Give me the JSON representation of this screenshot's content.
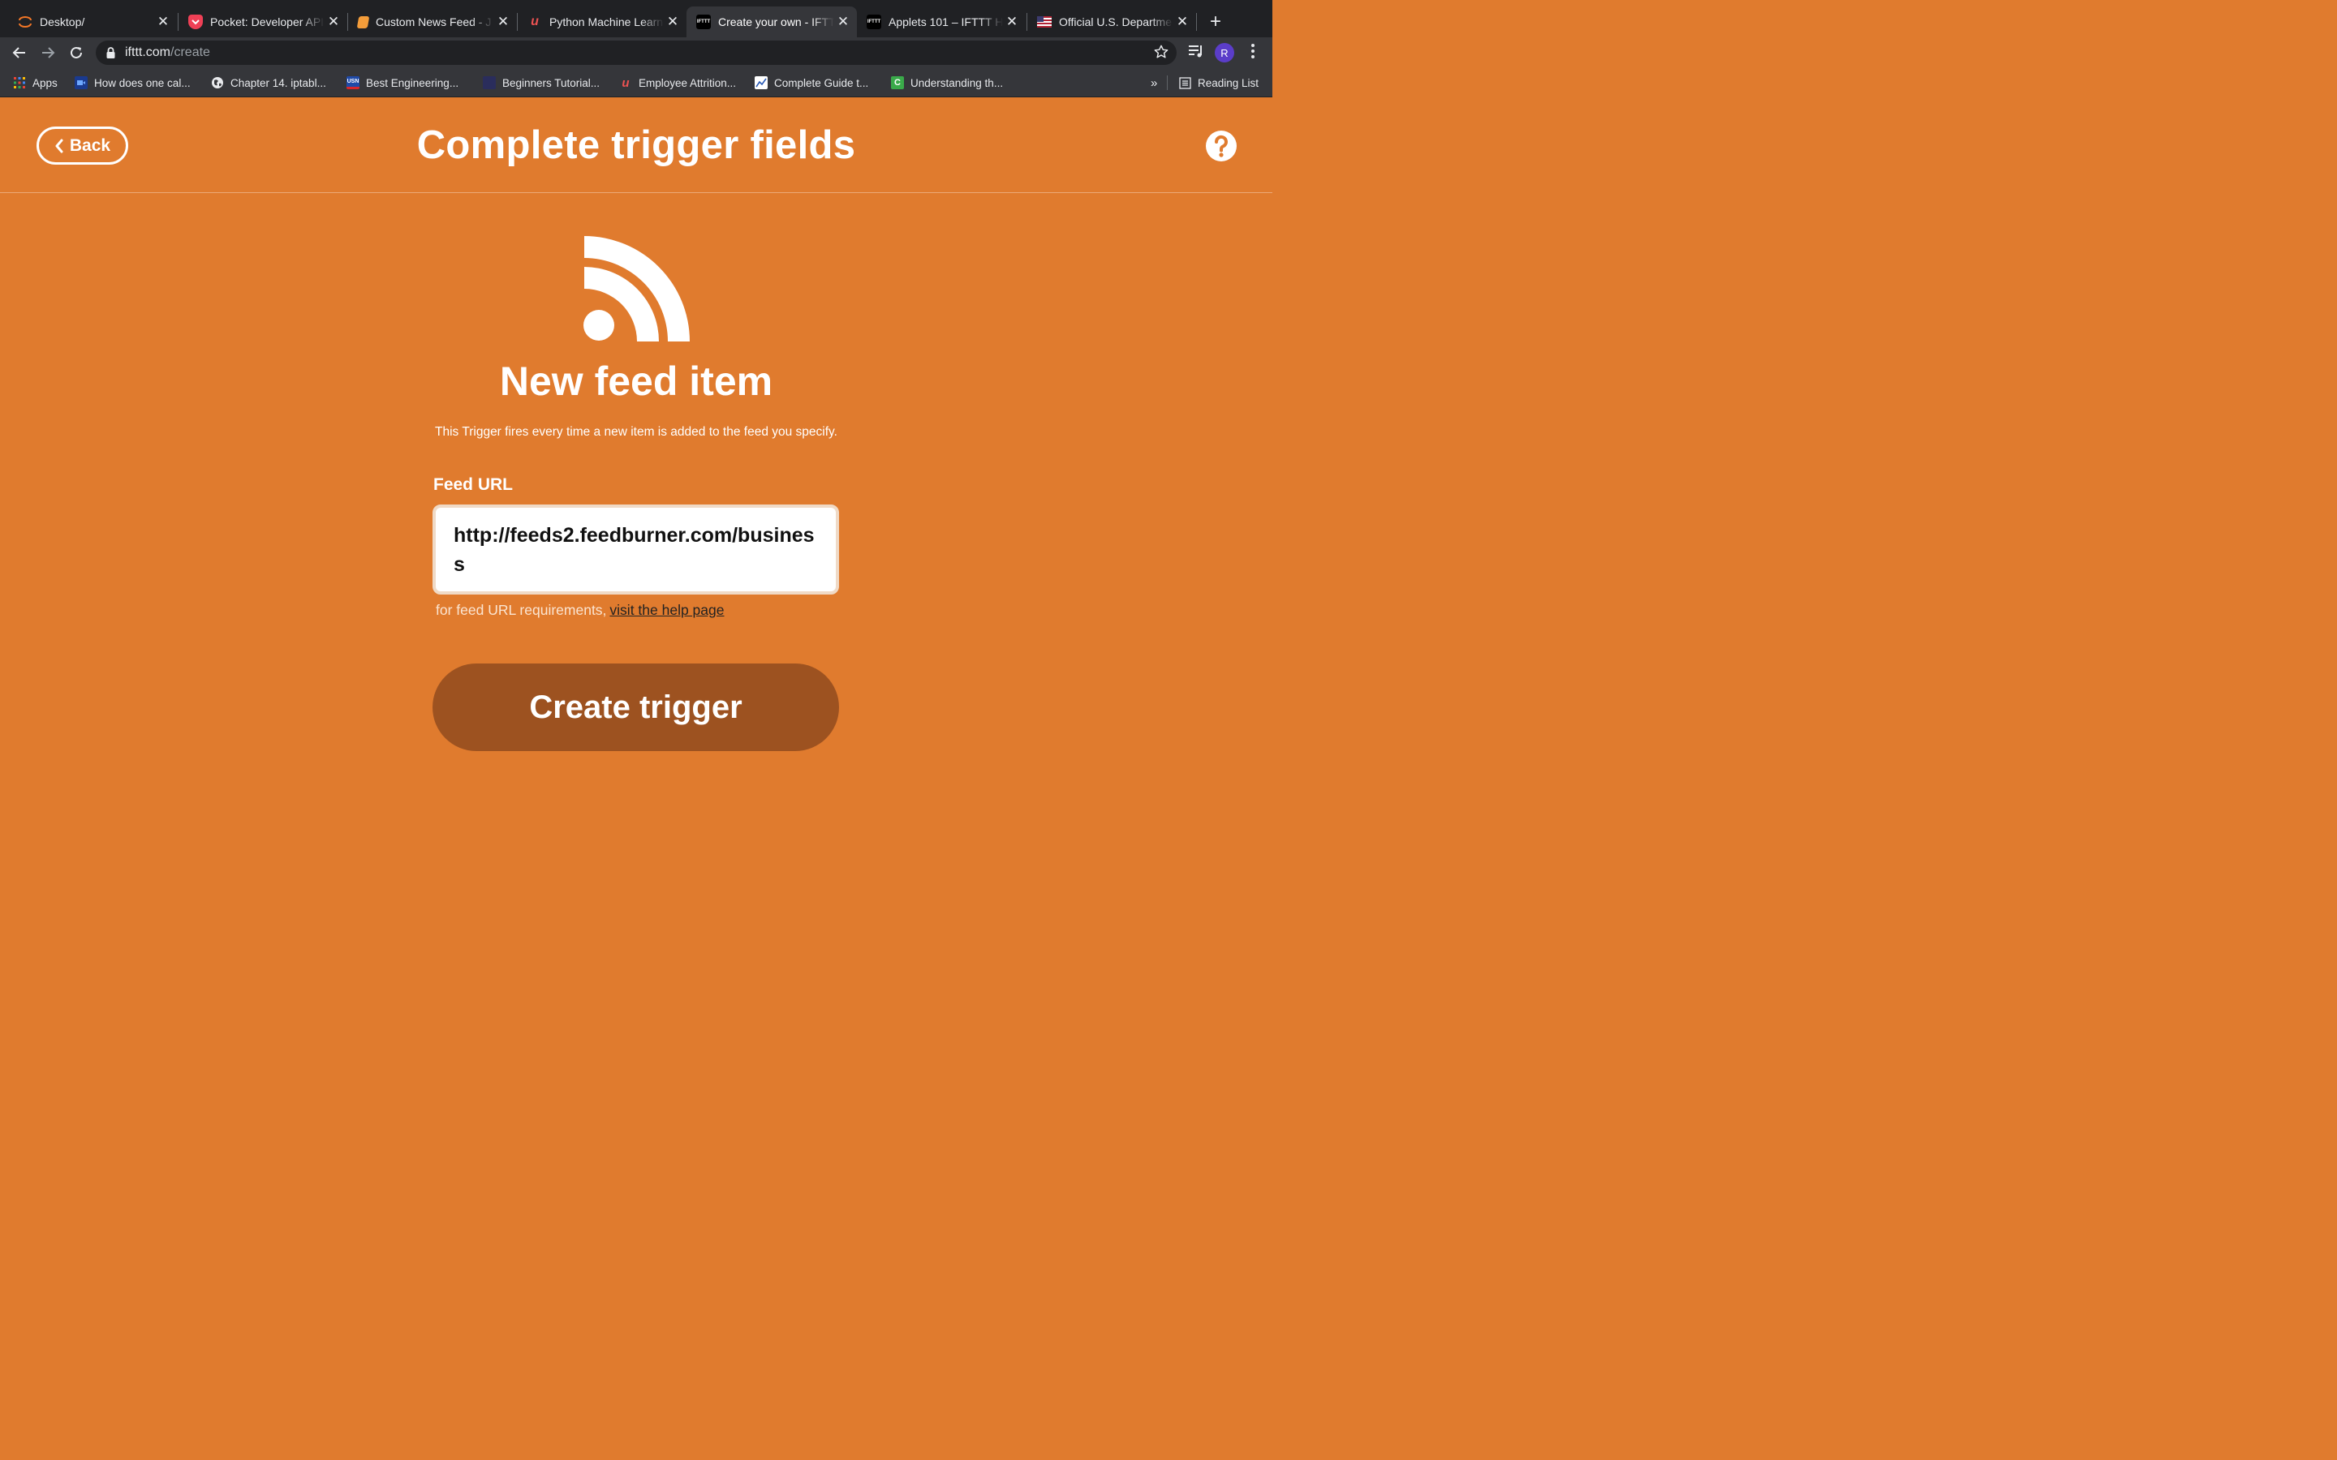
{
  "browser": {
    "tabs": [
      {
        "title": "Desktop/",
        "icon": "jupyter-icon",
        "active": false
      },
      {
        "title": "Pocket: Developer API",
        "icon": "pocket-icon",
        "active": false
      },
      {
        "title": "Custom News Feed - J",
        "icon": "notebook-icon",
        "active": false
      },
      {
        "title": "Python Machine Learni",
        "icon": "udemy-icon",
        "active": false
      },
      {
        "title": "Create your own - IFTT",
        "icon": "ifttt-icon",
        "active": true
      },
      {
        "title": "Applets 101 – IFTTT He",
        "icon": "ifttt-icon",
        "active": false
      },
      {
        "title": "Official U.S. Departme",
        "icon": "us-flag-icon",
        "active": false
      }
    ],
    "url_host": "ifttt.com",
    "url_path": "/create",
    "profile_initial": "R",
    "bookmarks": [
      {
        "label": "Apps",
        "icon": "apps-grid-icon"
      },
      {
        "label": "How does one cal...",
        "icon": "video-icon"
      },
      {
        "label": "Chapter 14. iptabl...",
        "icon": "globe-icon"
      },
      {
        "label": "Best Engineering...",
        "icon": "usn-icon"
      },
      {
        "label": "Beginners Tutorial...",
        "icon": "blank-page-icon"
      },
      {
        "label": "Employee Attrition...",
        "icon": "udemy-icon"
      },
      {
        "label": "Complete Guide t...",
        "icon": "chart-icon"
      },
      {
        "label": "Understanding th...",
        "icon": "c-icon"
      }
    ],
    "overflow_label": "»",
    "reading_list_label": "Reading List"
  },
  "page": {
    "back_label": "Back",
    "title": "Complete trigger fields",
    "trigger_name": "New feed item",
    "trigger_description": "This Trigger fires every time a new item is added to the feed you specify.",
    "field_label": "Feed URL",
    "field_value": "http://feeds2.feedburner.com/business",
    "hint_text": "for feed URL requirements,",
    "hint_link": "visit the help page",
    "create_button": "Create trigger"
  },
  "colors": {
    "background": "#e07b2e",
    "button": "#9d5220"
  }
}
